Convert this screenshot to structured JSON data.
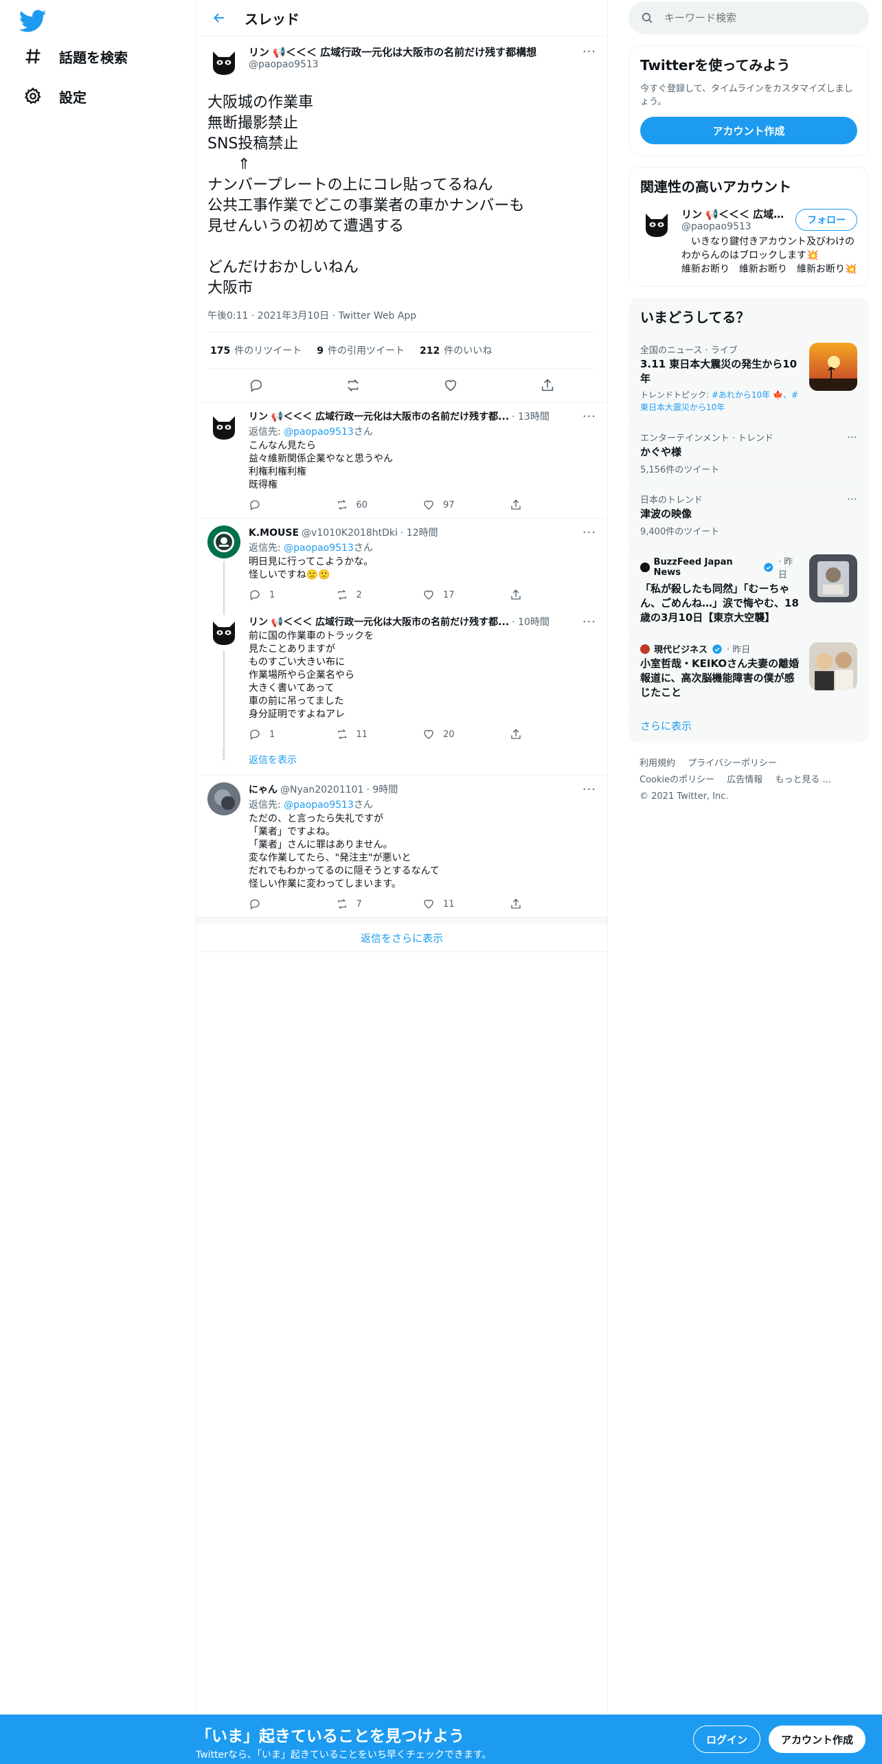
{
  "nav": {
    "explore_label": "話題を検索",
    "settings_label": "設定"
  },
  "header": {
    "title": "スレッド"
  },
  "main_tweet": {
    "name": "リン 📢＜＜＜ 広域行政一元化は大阪市の名前だけ残す都構想",
    "handle": "@paopao9513",
    "text": "大阪城の作業車\n無断撮影禁止\nSNS投稿禁止\n　　⇑\nナンバープレートの上にコレ貼ってるねん\n公共工事作業でどこの事業者の車かナンバーも\n見せんいうの初めて遭遇する\n\nどんだけおかしいねん\n大阪市",
    "meta": "午後0:11 · 2021年3月10日 · Twitter Web App",
    "retweets_count": "175",
    "retweets_label": "件のリツイート",
    "quotes_count": "9",
    "quotes_label": "件の引用ツイート",
    "likes_count": "212",
    "likes_label": "件のいいね"
  },
  "replies": [
    {
      "name": "リン 📢＜＜＜ 広域行政一元化は大阪市の名前だけ残す都...",
      "handle": "",
      "time": "· 13時間",
      "replying_prefix": "返信先: ",
      "replying_to": "@paopao9513",
      "replying_suffix": "さん",
      "text": "こんなん見たら\n益々維新関係企業やなと思うやん\n利権利権利権\n既得権",
      "reply_count": "",
      "retweet_count": "60",
      "like_count": "97"
    },
    {
      "name": "K.MOUSE",
      "handle": "@v1010K2018htDki",
      "time": "· 12時間",
      "replying_prefix": "返信先: ",
      "replying_to": "@paopao9513",
      "replying_suffix": "さん",
      "text": "明日見に行ってこようかな。\n怪しいですね🙁🙁",
      "reply_count": "1",
      "retweet_count": "2",
      "like_count": "17"
    },
    {
      "name": "リン 📢＜＜＜ 広域行政一元化は大阪市の名前だけ残す都...",
      "handle": "",
      "time": "· 10時間",
      "text": "前に国の作業車のトラックを\n見たことありますが\nものすごい大きい布に\n作業場所やら企業名やら\n大きく書いてあって\n車の前に吊ってました\n身分証明ですよねアレ",
      "reply_count": "1",
      "retweet_count": "11",
      "like_count": "20"
    },
    {
      "name": "にゃん",
      "handle": "@Nyan20201101",
      "time": "· 9時間",
      "replying_prefix": "返信先: ",
      "replying_to": "@paopao9513",
      "replying_suffix": "さん",
      "text": "ただの、と言ったら失礼ですが\n「業者」ですよね。\n「業者」さんに罪はありません。\n変な作業してたら、\"発注主\"が悪いと\nだれでもわかってるのに隠そうとするなんて\n怪しい作業に変わってしまいます。",
      "reply_count": "",
      "retweet_count": "7",
      "like_count": "11"
    }
  ],
  "show_replies_label": "返信を表示",
  "show_more_replies_label": "返信をさらに表示",
  "search": {
    "placeholder": "キーワード検索"
  },
  "signup_card": {
    "title": "Twitterを使ってみよう",
    "desc": "今すぐ登録して、タイムラインをカスタマイズしましょう。",
    "button": "アカウント作成"
  },
  "related": {
    "title": "関連性の高いアカウント",
    "name": "リン 📢＜＜＜ 広域...",
    "handle": "@paopao9513",
    "follow": "フォロー",
    "bio": "　いきなり鍵付きアカウント及びわけのわからんのはブロックします💥　　　　　維新お断り　維新お断り　維新お断り💥"
  },
  "trends": {
    "title": "いまどうしてる？",
    "items": [
      {
        "context": "全国のニュース · ライブ",
        "name": "3.11 東日本大震災の発生から10年",
        "topic_prefix": "トレンドトピック: ",
        "topic": "#あれから10年 🍁、#東日本大震災から10年"
      },
      {
        "context": "エンターテインメント · トレンド",
        "name": "かぐや様",
        "count": "5,156件のツイート"
      },
      {
        "context": "日本のトレンド",
        "name": "津波の映像",
        "count": "9,400件のツイート"
      },
      {
        "source": "BuzzFeed Japan News",
        "time": "· 昨日",
        "name": "「私が殺したも同然」「むーちゃん、ごめんね…」涙で悔やむ、18歳の3月10日【東京大空襲】"
      },
      {
        "source": "現代ビジネス",
        "time": "· 昨日",
        "name": "小室哲哉・KEIKOさん夫妻の離婚報道に、高次脳機能障害の僕が感じたこと"
      }
    ],
    "show_more": "さらに表示"
  },
  "footer": {
    "links": [
      "利用規約",
      "プライバシーポリシー",
      "Cookieのポリシー",
      "広告情報",
      "もっと見る ..."
    ],
    "copyright": "© 2021 Twitter, Inc."
  },
  "bottom_bar": {
    "title": "「いま」起きていることを見つけよう",
    "subtitle": "Twitterなら、「いま」起きていることをいち早くチェックできます。",
    "login": "ログイン",
    "signup": "アカウント作成"
  },
  "colors": {
    "accent": "#1d9bf0",
    "text": "#0f1419",
    "muted": "#536471"
  }
}
